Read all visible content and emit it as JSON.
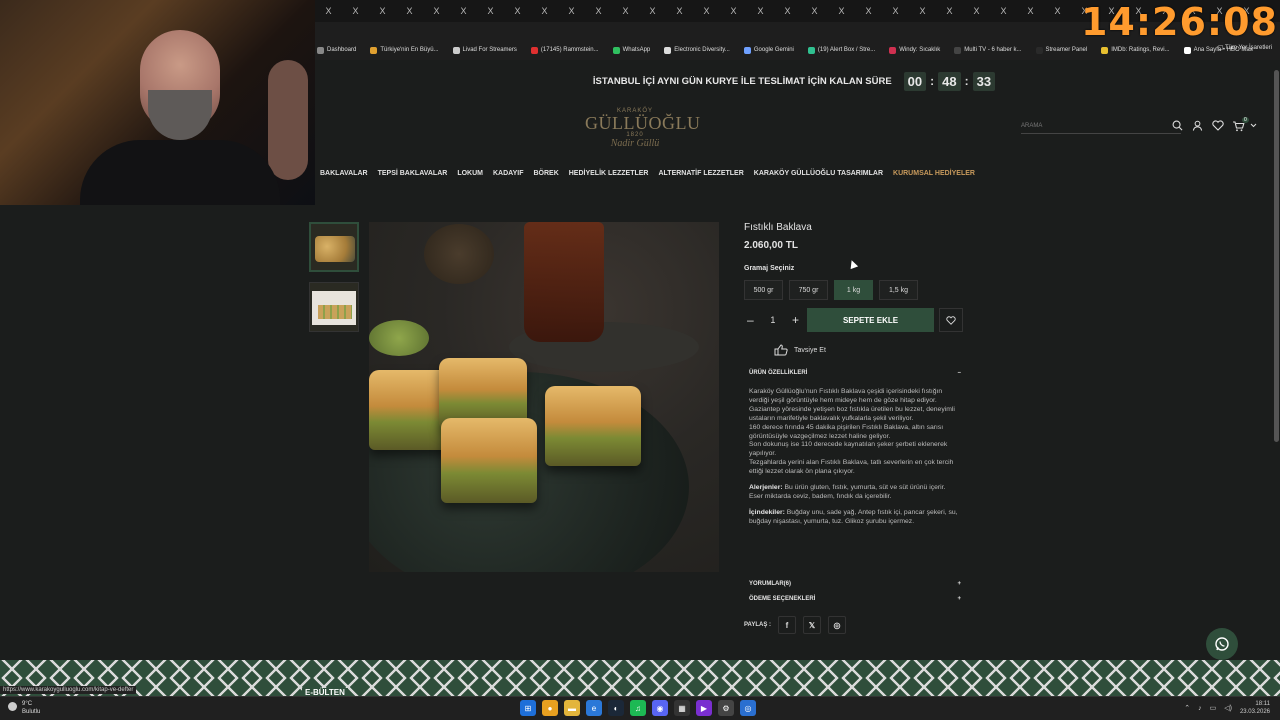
{
  "stream": {
    "clock": "14:26:08"
  },
  "browser": {
    "tabs": [
      "X",
      "X",
      "X",
      "X",
      "X",
      "X",
      "X",
      "X",
      "X",
      "X",
      "X",
      "X",
      "X",
      "X",
      "X",
      "X",
      "X",
      "X",
      "X",
      "X",
      "X",
      "X",
      "X",
      "X",
      "X",
      "X",
      "X",
      "X",
      "X",
      "X",
      "X",
      "X",
      "X",
      "X",
      "X"
    ],
    "bookmarks": [
      {
        "label": "Dashboard",
        "color": "#888888"
      },
      {
        "label": "Türkiye'nin En Büyü...",
        "color": "#e0a030"
      },
      {
        "label": "Livad For Streamers",
        "color": "#cccccc"
      },
      {
        "label": "(17145) Rammstein...",
        "color": "#e03030"
      },
      {
        "label": "WhatsApp",
        "color": "#30c060"
      },
      {
        "label": "Electronic Diversity...",
        "color": "#dddddd"
      },
      {
        "label": "Google Gemini",
        "color": "#6fa0ff"
      },
      {
        "label": "(19) Alert Box / Stre...",
        "color": "#30c090"
      },
      {
        "label": "Windy: Sıcaklık",
        "color": "#d03050"
      },
      {
        "label": "Multi TV - 6 haber k...",
        "color": "#444444"
      },
      {
        "label": "Streamer Panel",
        "color": "#2a2a2a"
      },
      {
        "label": "IMDb: Ratings, Revi...",
        "color": "#e8c030"
      },
      {
        "label": "Ana Sayfa • HBO Max",
        "color": "#ffffff"
      }
    ],
    "bookmarks_all": "Tüm Yer İşaretleri",
    "status_url": "https://www.karakoygulluoglu.com/kitap-ve-defter"
  },
  "site": {
    "promo_text": "İSTANBUL İÇİ AYNI GÜN KURYE İLE TESLİMAT İÇİN KALAN SÜRE",
    "timer": {
      "h": "00",
      "m": "48",
      "s": "33"
    },
    "logo": {
      "small": "KARAKÖY",
      "big": "GÜLLÜOĞLU",
      "since": "1820",
      "script": "Nadir Güllü"
    },
    "search_placeholder": "ARAMA",
    "cart_count": "0",
    "nav": [
      {
        "label": "BAKLAVALAR",
        "accent": false
      },
      {
        "label": "TEPSİ BAKLAVALAR",
        "accent": false
      },
      {
        "label": "LOKUM",
        "accent": false
      },
      {
        "label": "KADAYIF",
        "accent": false
      },
      {
        "label": "BÖREK",
        "accent": false
      },
      {
        "label": "HEDİYELİK LEZZETLER",
        "accent": false
      },
      {
        "label": "ALTERNATİF LEZZETLER",
        "accent": false
      },
      {
        "label": "KARAKÖY GÜLLÜOĞLU TASARIMLAR",
        "accent": false
      },
      {
        "label": "KURUMSAL HEDİYELER",
        "accent": true
      }
    ],
    "product": {
      "title": "Fıstıklı Baklava",
      "price": "2.060,00 TL",
      "gram_label": "Gramaj Seçiniz",
      "options": [
        {
          "label": "500 gr",
          "selected": false
        },
        {
          "label": "750 gr",
          "selected": false
        },
        {
          "label": "1 kg",
          "selected": true
        },
        {
          "label": "1,5 kg",
          "selected": false
        }
      ],
      "qty": "1",
      "add_to_cart": "SEPETE EKLE",
      "recommend": "Tavsiye Et"
    },
    "features": {
      "title": "ÜRÜN ÖZELLİKLERİ",
      "toggle": "–",
      "paragraph1": "Karaköy Güllüoğlu'nun Fıstıklı Baklava çeşidi içerisindeki fıstığın verdiği yeşil görüntüyle hem mideye hem de göze hitap ediyor.",
      "paragraph2": "Gaziantep yöresinde yetişen boz fıstıkla üretilen bu lezzet, deneyimli ustaların marifetiyle baklavalık yufkalarla şekil veriliyor.",
      "paragraph3": "160 derece fırında 45 dakika pişirilen Fıstıklı Baklava, altın sarısı görüntüsüyle vazgeçilmez lezzet haline geliyor.",
      "paragraph4": "Son dokunuş ise 110 derecede kaynatılan şeker şerbeti eklenerek yapılıyor.",
      "paragraph5": "Tezgahlarda yerini alan Fıstıklı Baklava, tatlı severlerin en çok tercih ettiği lezzet olarak ön plana çıkıyor.",
      "allergen_label": "Alerjenler:",
      "allergen_text": " Bu ürün gluten, fıstık, yumurta, süt ve süt ürünü içerir. Eser miktarda ceviz, badem, fındık da içerebilir.",
      "ingredients_label": "İçindekiler:",
      "ingredients_text": " Buğday unu, sade yağ, Antep fıstık içi, pancar şekeri, su, buğday nişastası, yumurta, tuz. Glikoz şurubu içermez."
    },
    "reviews": {
      "title": "YORUMLAR(6)",
      "toggle": "+"
    },
    "payment": {
      "title": "ÖDEME SEÇENEKLERİ",
      "toggle": "+"
    },
    "share_label": "PAYLAŞ :",
    "newsletter": "E-BÜLTEN"
  },
  "taskbar": {
    "temp": "9°C",
    "weather": "Bulutlu",
    "time": "18:11",
    "date": "23.03.2026"
  }
}
